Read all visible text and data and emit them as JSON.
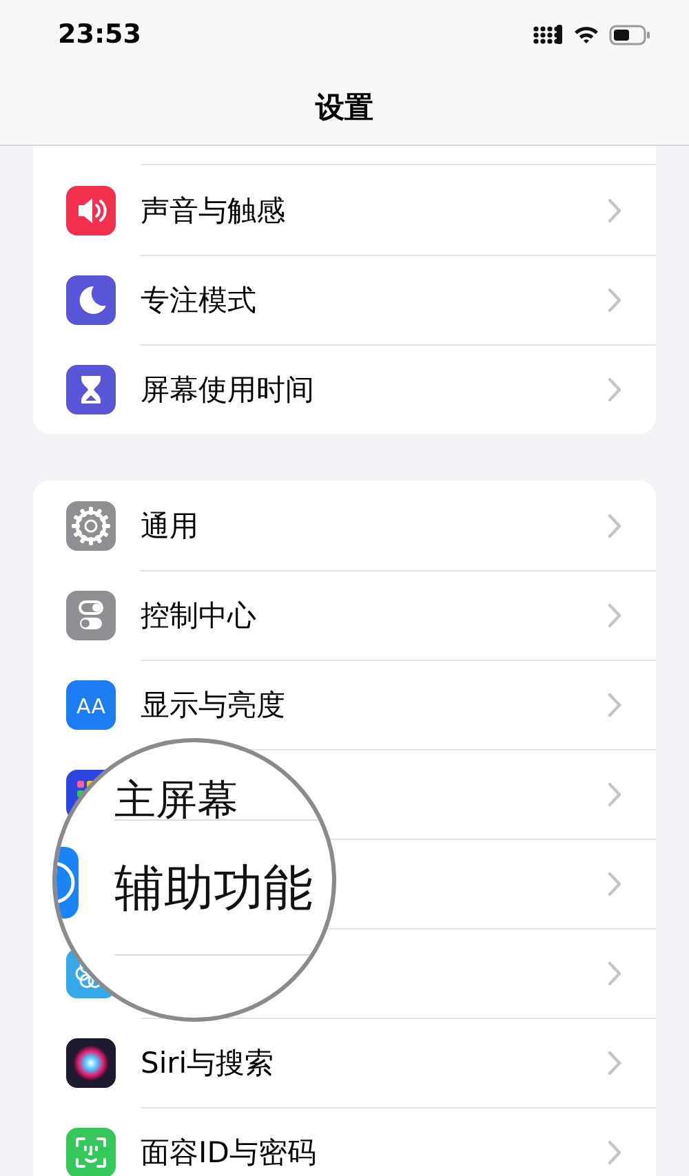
{
  "status_bar": {
    "time": "23:53"
  },
  "nav": {
    "title": "设置"
  },
  "groups": [
    {
      "rows": [
        {
          "kind": "speaker",
          "label": "声音与触感"
        },
        {
          "kind": "moon",
          "label": "专注模式"
        },
        {
          "kind": "hourglass",
          "label": "屏幕使用时间"
        }
      ]
    },
    {
      "rows": [
        {
          "kind": "gear",
          "label": "通用"
        },
        {
          "kind": "toggles",
          "label": "控制中心"
        },
        {
          "kind": "letters",
          "icon_text": "AA",
          "label": "显示与亮度"
        },
        {
          "kind": "grid"
        },
        {
          "kind": "none"
        },
        {
          "kind": "flower"
        },
        {
          "kind": "orb",
          "label": "Siri与搜索"
        },
        {
          "kind": "face",
          "label": "面容ID与密码"
        }
      ]
    }
  ],
  "magnifier": {
    "texts": [
      "主屏幕",
      "辅助功能"
    ]
  }
}
